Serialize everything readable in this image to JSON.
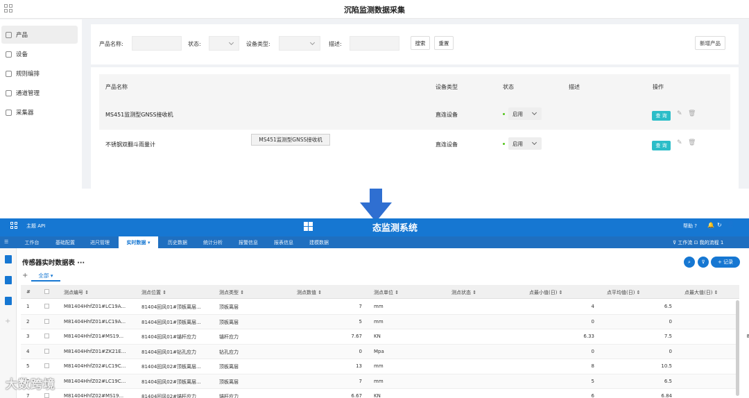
{
  "top": {
    "title": "沉陷监测数据采集",
    "sidebar": [
      {
        "label": "产品",
        "icon": "cube-icon",
        "active": true
      },
      {
        "label": "设备",
        "icon": "device-icon",
        "active": false
      },
      {
        "label": "规则编排",
        "icon": "rule-icon",
        "active": false
      },
      {
        "label": "通道管理",
        "icon": "channel-icon",
        "active": false
      },
      {
        "label": "采集器",
        "icon": "collector-icon",
        "active": false
      }
    ],
    "filter": {
      "product_name_label": "产品名称:",
      "status_label": "状态:",
      "device_type_label": "设备类型:",
      "desc_label": "描述:",
      "search_btn": "搜索",
      "reset_btn": "重置",
      "add_btn": "新增产品"
    },
    "table": {
      "headers": [
        "产品名称",
        "设备类型",
        "状态",
        "描述",
        "操作"
      ],
      "rows": [
        {
          "name": "MS451监测型GNSS接收机",
          "type": "直连设备",
          "status": "启用",
          "desc": "",
          "query": "查 询"
        },
        {
          "name": "不锈钢双翻斗雨量计",
          "type": "直连设备",
          "status": "启用",
          "desc": "",
          "query": "查 询"
        }
      ],
      "tooltip": "MS451监测型GNSS接收机"
    }
  },
  "bottom": {
    "theme": "主题  API",
    "system_title": "态监测系统",
    "header_right": "帮助 ?",
    "nav": [
      "工作台",
      "基础配置",
      "进尺管理",
      "实时数据 ▾",
      "历史数据",
      "统计分析",
      "报警信息",
      "报表信息",
      "建模数据"
    ],
    "nav_active_index": 3,
    "nav_right": "⊽ 工作流   ⊡ 我的流程 1",
    "page_title": "传感器实时数据表 ···",
    "tab_all": "全部 ▾",
    "add_record": "+ 记录",
    "headers": [
      "#",
      "测点编号 ⇕",
      "测点位置 ⇕",
      "测点类型 ⇕",
      "测点数值 ⇕",
      "测点单位 ⇕",
      "测点状态 ⇕",
      "点最小值(日) ⇕",
      "点平均值(日) ⇕",
      "点最大值(日) ⇕"
    ],
    "rows": [
      {
        "no": "1",
        "code": "M81404HhfZ01#LC19A...",
        "pos": "81404回风01#顶板离层...",
        "type": "顶板离层",
        "value": "7",
        "unit": "mm",
        "min": "4",
        "avg": "6.5",
        "max": ""
      },
      {
        "no": "2",
        "code": "M81404HhfZ01#LC19A...",
        "pos": "81404回风01#顶板离层...",
        "type": "顶板离层",
        "value": "5",
        "unit": "mm",
        "min": "0",
        "avg": "0",
        "max": ""
      },
      {
        "no": "3",
        "code": "M81404HhfZ01#MS19...",
        "pos": "81404回风01#锚杆应力",
        "type": "锚杆应力",
        "value": "7.67",
        "unit": "KN",
        "min": "6.33",
        "avg": "7.5",
        "max": "8"
      },
      {
        "no": "4",
        "code": "M81404HhfZ01#ZK21E...",
        "pos": "81404回风01#钻孔应力",
        "type": "钻孔应力",
        "value": "0",
        "unit": "Mpa",
        "min": "0",
        "avg": "0",
        "max": ""
      },
      {
        "no": "5",
        "code": "M81404HhfZ02#LC19C...",
        "pos": "81404回风02#顶板离层...",
        "type": "顶板离层",
        "value": "13",
        "unit": "mm",
        "min": "8",
        "avg": "10.5",
        "max": ""
      },
      {
        "no": "6",
        "code": "M81404HhfZ02#LC19C...",
        "pos": "81404回风02#顶板离层...",
        "type": "顶板离层",
        "value": "7",
        "unit": "mm",
        "min": "5",
        "avg": "6.5",
        "max": ""
      },
      {
        "no": "7",
        "code": "M81404HhfZ02#MS19...",
        "pos": "81404回风02#锚杆应力",
        "type": "锚杆应力",
        "value": "6.67",
        "unit": "KN",
        "min": "6",
        "avg": "6.84",
        "max": ""
      }
    ]
  },
  "watermark": "大数跨境"
}
